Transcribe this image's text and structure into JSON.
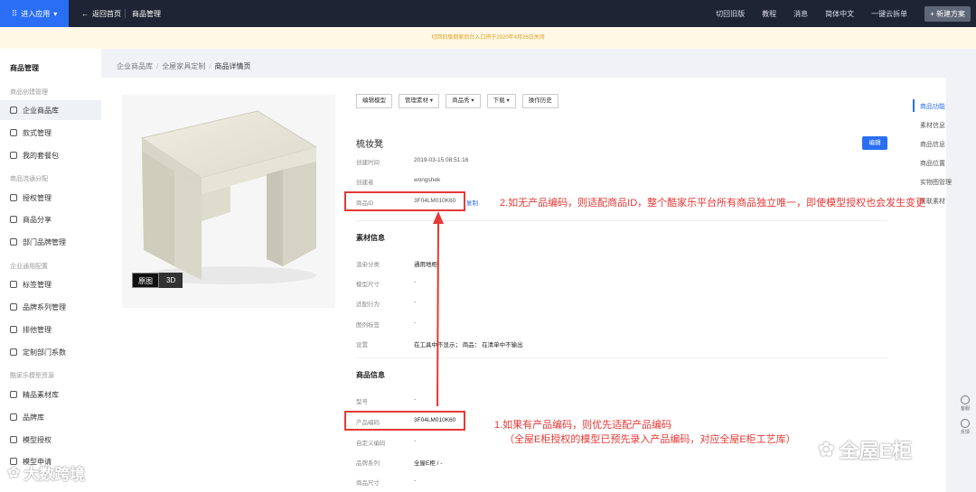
{
  "topbar": {
    "apps_label": "进入应用",
    "back_label": "返回首页",
    "crumb": "商品管理",
    "right_items": [
      "切回旧版",
      "教程",
      "消息",
      "简体中文",
      "一键云拆单"
    ],
    "new_plan": "+ 新建方案"
  },
  "notice": "切回旧版商家后台入口将于2020年4月26日关闭",
  "sidebar": {
    "title": "商品管理",
    "groups": [
      "商品创建管理",
      "商品流通分配",
      "企业通用配置",
      "酷家乐模型资源"
    ],
    "items": [
      "企业商品库",
      "款式管理",
      "我的套餐包",
      "授权管理",
      "商品分享",
      "部门品牌管理",
      "标签管理",
      "品牌系列管理",
      "排他管理",
      "定制部门系数",
      "精品素材库",
      "品牌库",
      "模型授权",
      "模型申请"
    ]
  },
  "breadcrumb": [
    "企业商品库",
    "全屋家具定制",
    "商品详情页"
  ],
  "image_toggle": {
    "raw": "原图",
    "three_d": "3D"
  },
  "toolbar": [
    "编辑模型",
    "管理素材 ▾",
    "商品秀 ▾",
    "下载 ▾",
    "操作历史"
  ],
  "product": {
    "name": "梳妆凳",
    "edit": "编辑",
    "created_label": "创建时间",
    "created": "2019-03-15 08:51:16",
    "creator_label": "创建者",
    "creator": "wongshek",
    "id_label": "商品ID",
    "id": "3F04LM010K60",
    "id_link": "复制"
  },
  "material": {
    "title": "素材信息",
    "rows": [
      {
        "label": "渲染分类",
        "value": "通用地柜"
      },
      {
        "label": "模型尺寸",
        "value": "-"
      },
      {
        "label": "适配行为",
        "value": "-"
      },
      {
        "label": "图例标签",
        "value": "-"
      },
      {
        "label": "设置",
        "value": "在工具中不显示；  商品：  在清单中不输出"
      }
    ]
  },
  "info": {
    "title": "商品信息",
    "rows": [
      {
        "label": "型号",
        "value": "-"
      },
      {
        "label": "产品编码",
        "value": "3F04LM010K60"
      },
      {
        "label": "自定义编码",
        "value": "-"
      },
      {
        "label": "品牌系列",
        "value": "全屋E柜 / -"
      },
      {
        "label": "商品尺寸",
        "value": "-"
      }
    ]
  },
  "anchor_nav": [
    "商品功能",
    "素材信息",
    "商品信息",
    "商品位置",
    "实物图管理",
    "关联素材"
  ],
  "float_tools": [
    "客服",
    "反馈"
  ],
  "annotations": {
    "a2": "2.如无产品编码，则适配商品ID，整个酷家乐平台所有商品独立唯一，即使模型授权也会发生变更",
    "a1_line1": "1.如果有产品编码，则优先适配产品编码",
    "a1_line2": "（全屋E柜授权的模型已预先录入产品编码，对应全屋E柜工艺库）"
  },
  "watermarks": {
    "left": "大数跨境",
    "right": "全屋E柜"
  },
  "colors": {
    "accent": "#2a6ef5",
    "annotation": "#e53935",
    "topbar": "#1e2434"
  }
}
